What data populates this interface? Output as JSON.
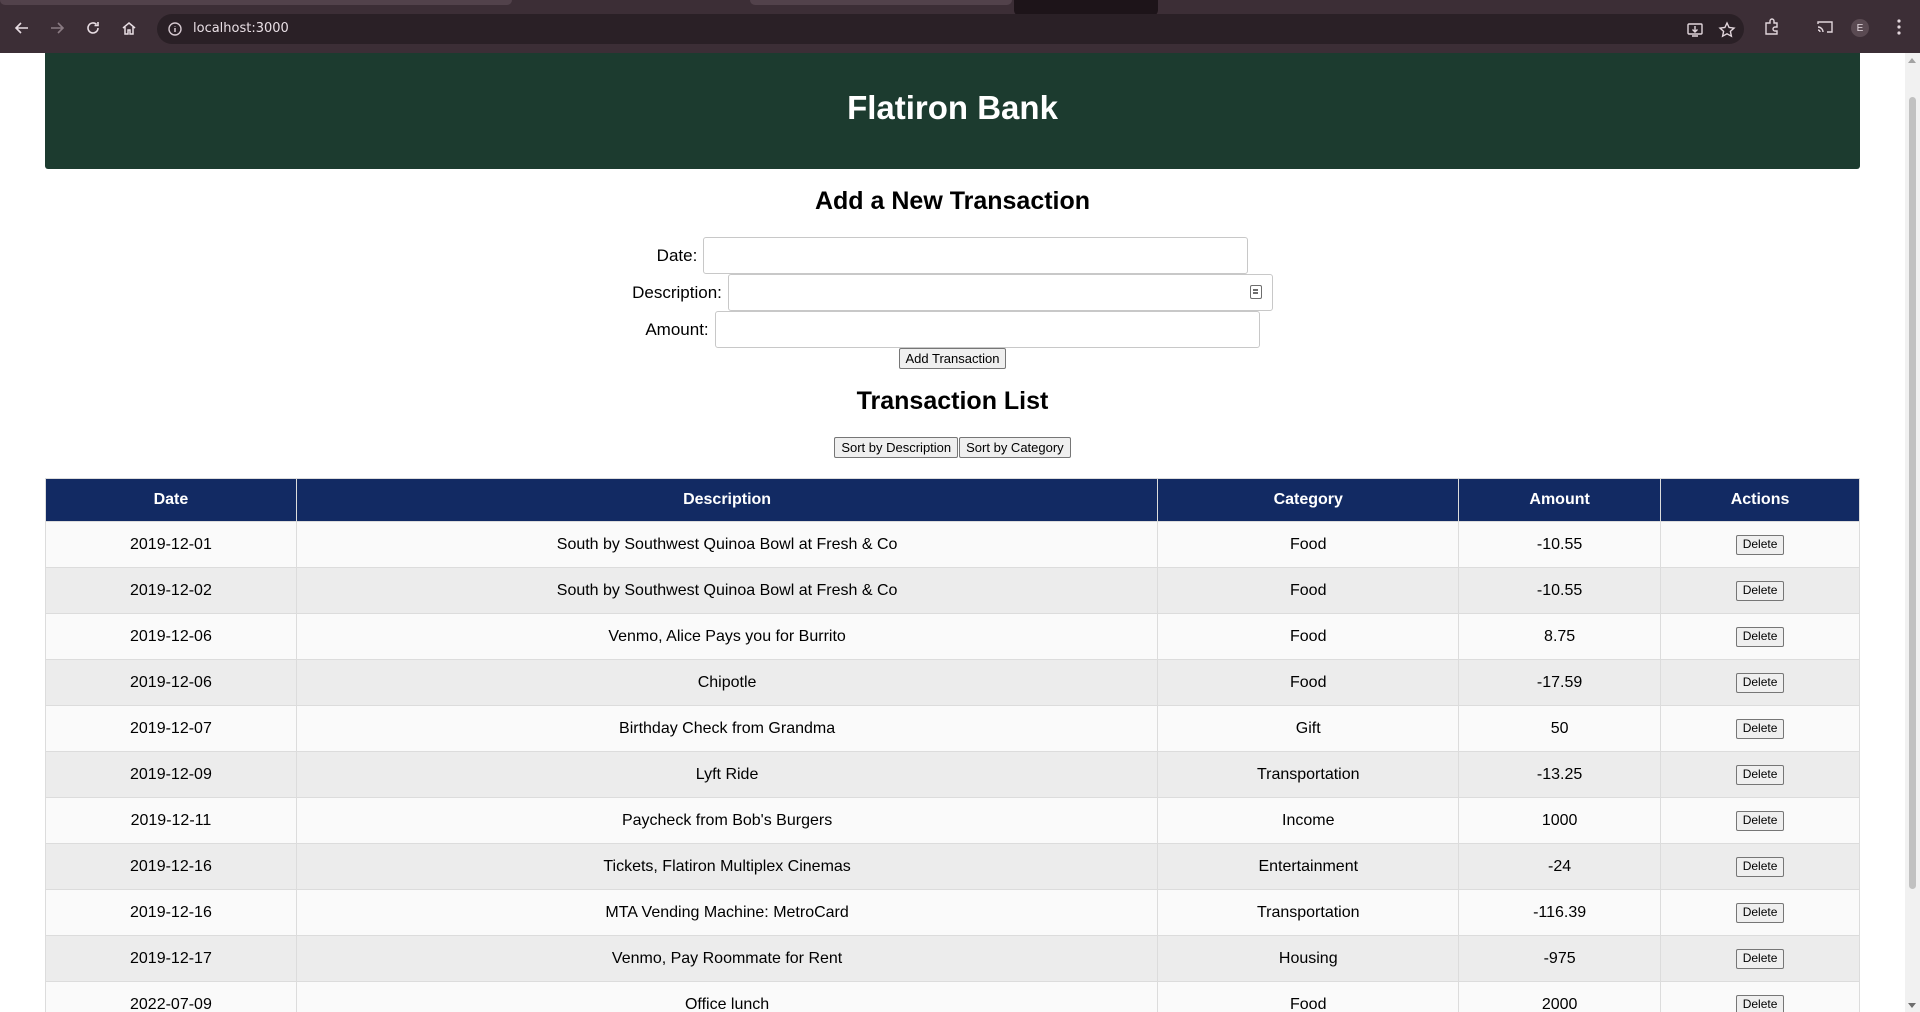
{
  "browser": {
    "url": "localhost:3000",
    "profile_initial": "E"
  },
  "header": {
    "title": "Flatiron Bank",
    "bg_color": "#1c3b2f"
  },
  "form": {
    "title": "Add a New Transaction",
    "date_label": "Date:",
    "date_value": "",
    "description_label": "Description:",
    "description_value": "",
    "amount_label": "Amount:",
    "amount_value": "",
    "submit_label": "Add Transaction"
  },
  "list": {
    "title": "Transaction List",
    "sort_description_label": "Sort by Description",
    "sort_category_label": "Sort by Category",
    "header_color": "#122a63",
    "columns": [
      "Date",
      "Description",
      "Category",
      "Amount",
      "Actions"
    ],
    "delete_label": "Delete",
    "rows": [
      {
        "date": "2019-12-01",
        "description": "South by Southwest Quinoa Bowl at Fresh & Co",
        "category": "Food",
        "amount": "-10.55"
      },
      {
        "date": "2019-12-02",
        "description": "South by Southwest Quinoa Bowl at Fresh & Co",
        "category": "Food",
        "amount": "-10.55"
      },
      {
        "date": "2019-12-06",
        "description": "Venmo, Alice Pays you for Burrito",
        "category": "Food",
        "amount": "8.75"
      },
      {
        "date": "2019-12-06",
        "description": "Chipotle",
        "category": "Food",
        "amount": "-17.59"
      },
      {
        "date": "2019-12-07",
        "description": "Birthday Check from Grandma",
        "category": "Gift",
        "amount": "50"
      },
      {
        "date": "2019-12-09",
        "description": "Lyft Ride",
        "category": "Transportation",
        "amount": "-13.25"
      },
      {
        "date": "2019-12-11",
        "description": "Paycheck from Bob's Burgers",
        "category": "Income",
        "amount": "1000"
      },
      {
        "date": "2019-12-16",
        "description": "Tickets, Flatiron Multiplex Cinemas",
        "category": "Entertainment",
        "amount": "-24"
      },
      {
        "date": "2019-12-16",
        "description": "MTA Vending Machine: MetroCard",
        "category": "Transportation",
        "amount": "-116.39"
      },
      {
        "date": "2019-12-17",
        "description": "Venmo, Pay Roommate for Rent",
        "category": "Housing",
        "amount": "-975"
      },
      {
        "date": "2022-07-09",
        "description": "Office lunch",
        "category": "Food",
        "amount": "2000"
      }
    ]
  }
}
